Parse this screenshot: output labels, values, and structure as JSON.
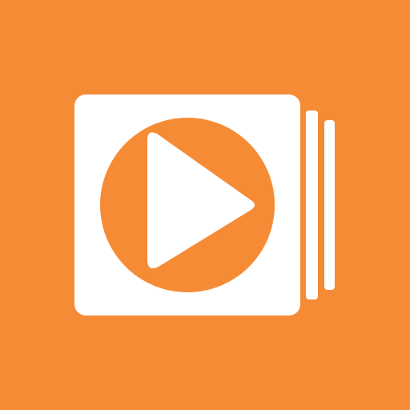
{
  "app_icon": {
    "icon": "video-playlist-icon",
    "colors": {
      "background": "#F68B35",
      "foreground": "#FFFFFF"
    }
  }
}
